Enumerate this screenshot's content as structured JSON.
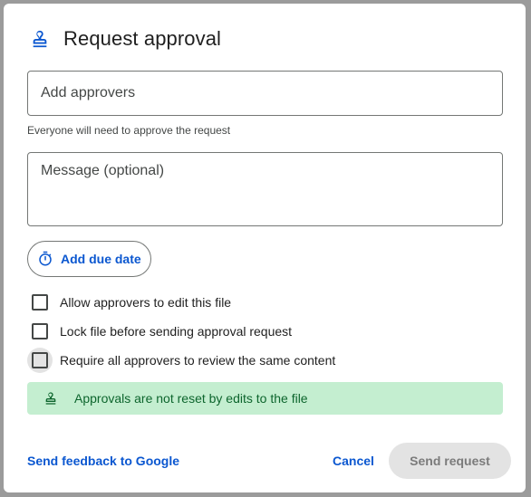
{
  "dialog": {
    "title": "Request approval",
    "approvers": {
      "placeholder": "Add approvers",
      "value": ""
    },
    "approvers_hint": "Everyone will need to approve the request",
    "message": {
      "placeholder": "Message (optional)",
      "value": ""
    },
    "due_date_label": "Add due date",
    "options": [
      {
        "label": "Allow approvers to edit this file",
        "checked": false
      },
      {
        "label": "Lock file before sending approval request",
        "checked": false
      },
      {
        "label": "Require all approvers to review the same content",
        "checked": false
      }
    ],
    "banner_text": "Approvals are not reset by edits to the file",
    "feedback_link": "Send feedback to Google",
    "cancel_label": "Cancel",
    "send_label": "Send request"
  },
  "icons": {
    "header": "approval-stamp-icon",
    "due_date": "timer-icon",
    "banner": "approval-stamp-icon"
  },
  "colors": {
    "accent": "#0b57d0",
    "banner_bg": "#c4eed0",
    "banner_text": "#0d652d",
    "disabled_bg": "#e3e3e3"
  }
}
